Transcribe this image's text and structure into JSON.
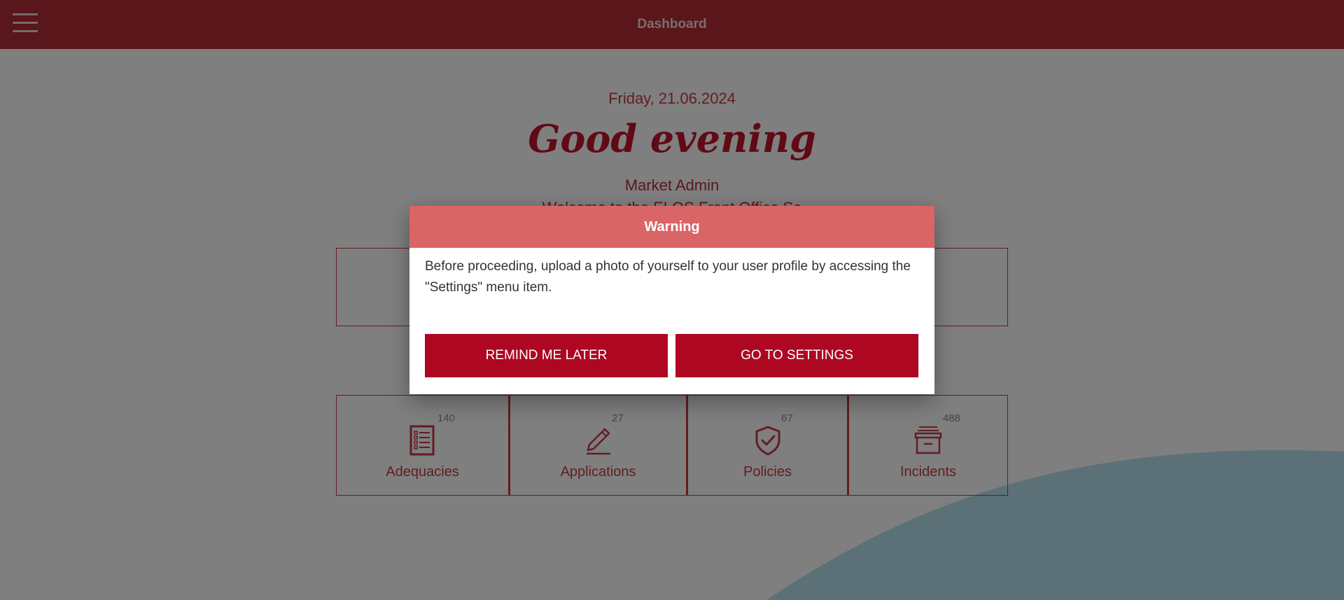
{
  "topbar": {
    "title": "Dashboard"
  },
  "greeting": {
    "date": "Friday, 21.06.2024",
    "salutation": "Good evening",
    "user": "Market Admin",
    "welcome": "Welcome to the ELOS Front Office Se"
  },
  "tiles": [
    {
      "label": "Adequacies",
      "count": "140",
      "icon": "checklist-icon"
    },
    {
      "label": "Applications",
      "count": "27",
      "icon": "pencil-icon"
    },
    {
      "label": "Policies",
      "count": "67",
      "icon": "shield-check-icon"
    },
    {
      "label": "Incidents",
      "count": "488",
      "icon": "archive-box-icon"
    }
  ],
  "modal": {
    "title": "Warning",
    "message": "Before proceeding, upload a photo of yourself to your user profile by accessing the \"Settings\" menu item.",
    "remind_label": "REMIND ME LATER",
    "settings_label": "GO TO SETTINGS"
  },
  "colors": {
    "brand": "#b22c36",
    "modal_header": "#d96566",
    "button": "#ad0722",
    "wave": "#b6e2ef"
  }
}
